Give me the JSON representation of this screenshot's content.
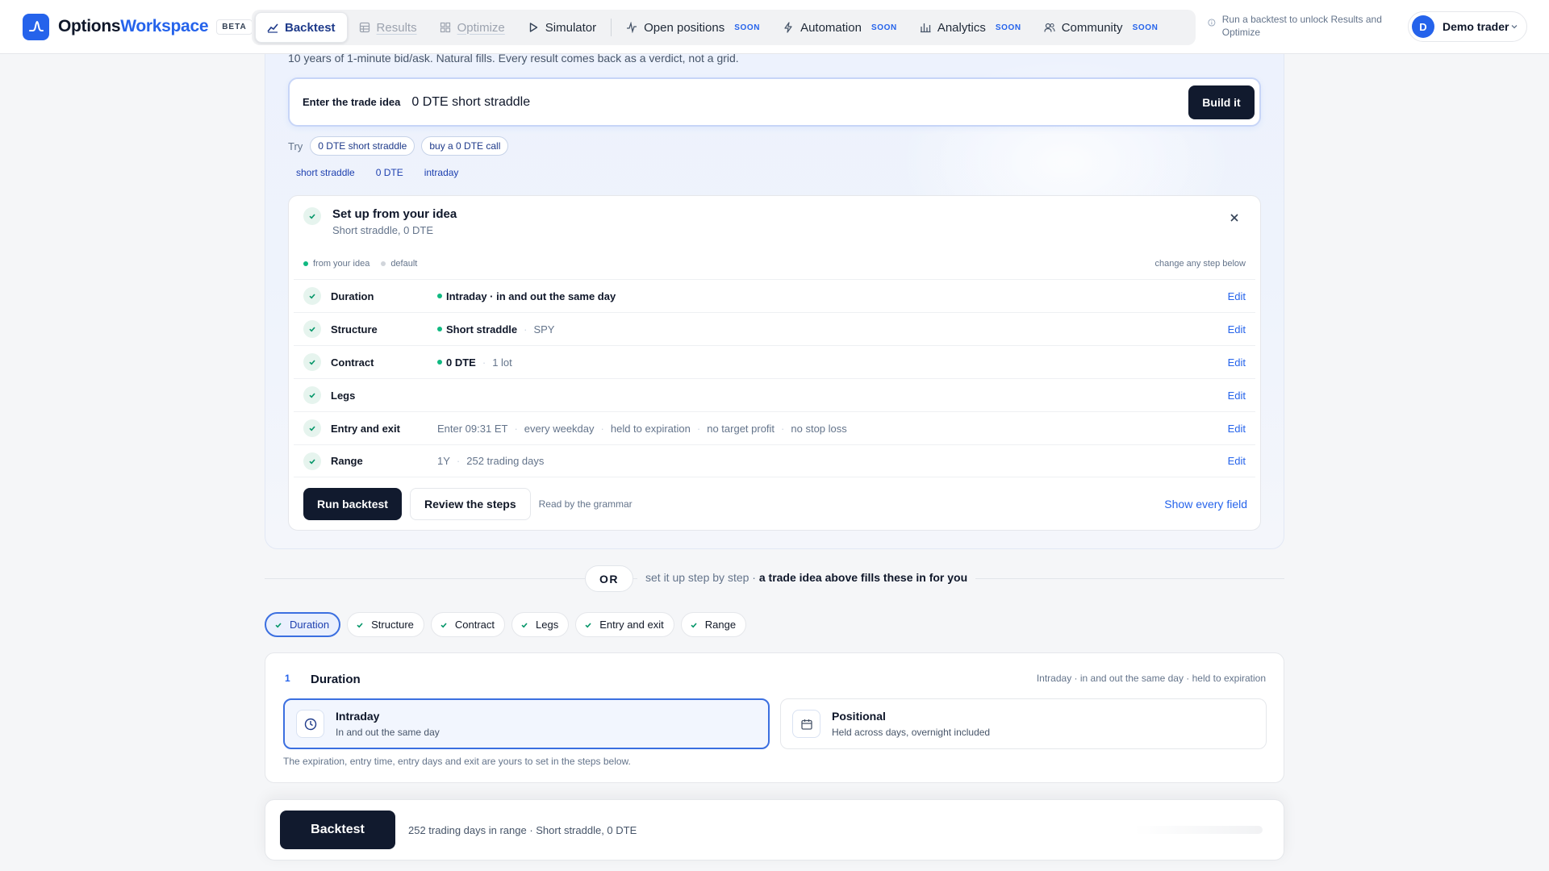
{
  "brand": {
    "name_part1": "Options",
    "name_part2": "Workspace",
    "badge": "BETA"
  },
  "nav": {
    "tabs": [
      {
        "label": "Backtest",
        "icon": "chart-line-icon",
        "state": "active"
      },
      {
        "label": "Results",
        "icon": "table-icon",
        "state": "disabled"
      },
      {
        "label": "Optimize",
        "icon": "grid-icon",
        "state": "disabled"
      },
      {
        "label": "Simulator",
        "icon": "play-icon",
        "state": "normal"
      },
      {
        "label": "Open positions",
        "icon": "pulse-icon",
        "soon": "SOON"
      },
      {
        "label": "Automation",
        "icon": "bolt-icon",
        "soon": "SOON"
      },
      {
        "label": "Analytics",
        "icon": "bar-chart-icon",
        "soon": "SOON"
      },
      {
        "label": "Community",
        "icon": "users-icon",
        "soon": "SOON"
      }
    ],
    "locked_tip": "Run a backtest to unlock Results and Optimize"
  },
  "user": {
    "initial": "D",
    "name": "Demo trader"
  },
  "hero": {
    "subline": "10 years of 1-minute bid/ask. Natural fills. Every result comes back as a verdict, not a grid.",
    "idea_label": "Enter the trade idea",
    "idea_value": "0 DTE short straddle",
    "build_label": "Build it",
    "try_label": "Try",
    "try_chips": [
      "0 DTE short straddle",
      "buy a 0 DTE call"
    ],
    "tags": [
      "short straddle",
      "0 DTE",
      "intraday"
    ]
  },
  "setup": {
    "title": "Set up from your idea",
    "subtitle": "Short straddle, 0 DTE",
    "legend_from": "from your idea",
    "legend_default": "default",
    "legend_right": "change any step below",
    "steps": [
      {
        "name": "Duration",
        "strong": "Intraday · in and out the same day",
        "rest": []
      },
      {
        "name": "Structure",
        "strong": "Short straddle",
        "rest": [
          "SPY"
        ]
      },
      {
        "name": "Contract",
        "strong": "0 DTE",
        "rest": [
          "1 lot"
        ]
      },
      {
        "name": "Legs",
        "strong": "",
        "rest": []
      },
      {
        "name": "Entry and exit",
        "strong": "",
        "rest": [
          "Enter 09:31 ET",
          "every weekday",
          "held to expiration",
          "no target profit",
          "no stop loss"
        ]
      },
      {
        "name": "Range",
        "strong": "",
        "rest": [
          "1Y",
          "252 trading days"
        ]
      }
    ],
    "edit_label": "Edit",
    "run_label": "Run backtest",
    "review_label": "Review the steps",
    "grammar_note": "Read by the grammar",
    "show_all_label": "Show every field"
  },
  "separator": {
    "or": "OR",
    "text_plain": "set it up step by step · ",
    "text_bold": "a trade idea above fills these in for you"
  },
  "pills": [
    "Duration",
    "Structure",
    "Contract",
    "Legs",
    "Entry and exit",
    "Range"
  ],
  "duration": {
    "number": "1",
    "title": "Duration",
    "summary": "Intraday · in and out the same day · held to expiration",
    "options": [
      {
        "title": "Intraday",
        "sub": "In and out the same day",
        "icon": "clock-icon"
      },
      {
        "title": "Positional",
        "sub": "Held across days, overnight included",
        "icon": "calendar-icon"
      }
    ],
    "note": "The expiration, entry time, entry days and exit are yours to set in the steps below."
  },
  "bottom": {
    "button": "Backtest",
    "summary": "252 trading days in range · Short straddle, 0 DTE"
  },
  "colors": {
    "accent": "#2563eb",
    "dark": "#111a2e",
    "success": "#10b981"
  }
}
